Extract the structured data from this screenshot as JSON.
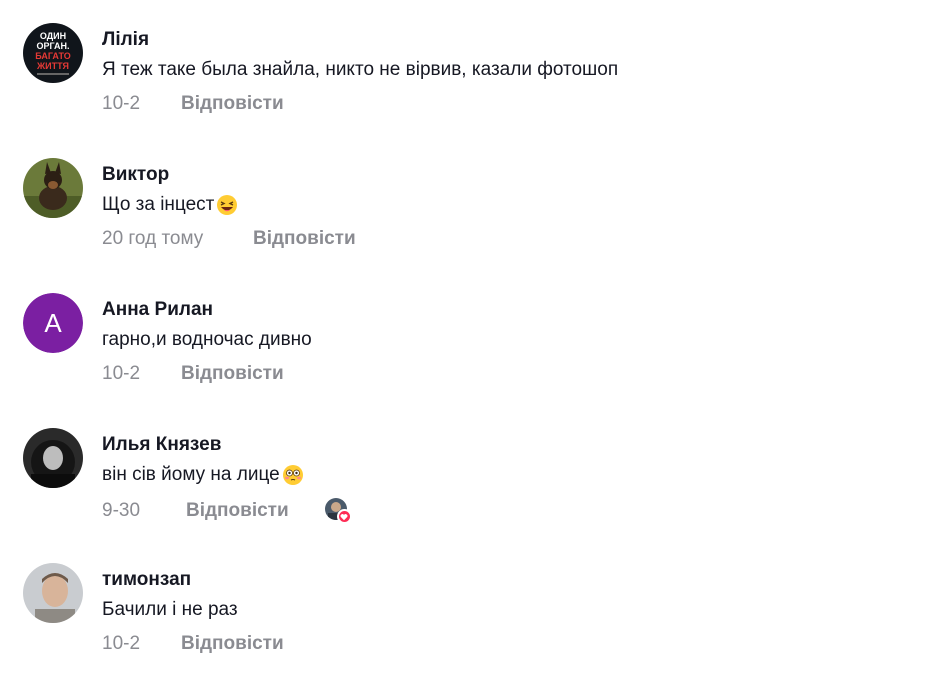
{
  "comments": [
    {
      "name": "Лілія",
      "text": "Я теж таке была знайла, никто не вірвив, казали фотошоп",
      "time": "10-2",
      "reply": "Відповісти",
      "avatar_lines": [
        "ОДИН",
        "ОРГАН.",
        "БАГАТО",
        "ЖИТТЯ"
      ]
    },
    {
      "name": "Виктор",
      "text": "Що за інцест",
      "emoji": "laughing-face",
      "time": "20 год тому",
      "reply": "Відповісти"
    },
    {
      "name": "Анна Рилан",
      "text": "гарно,и водночас дивно",
      "time": "10-2",
      "reply": "Відповісти",
      "avatar_letter": "A",
      "avatar_color": "#7b1fa2"
    },
    {
      "name": "Илья Князев",
      "text": "він сів йому на лице",
      "emoji": "flushed-face",
      "time": "9-30",
      "reply": "Відповісти",
      "liked_by_creator": true
    },
    {
      "name": "тимонзап",
      "text": "Бачили і не раз",
      "time": "10-2",
      "reply": "Відповісти"
    }
  ],
  "colors": {
    "name": "#161823",
    "meta": "#8a8b91",
    "heart": "#fe2c55"
  }
}
